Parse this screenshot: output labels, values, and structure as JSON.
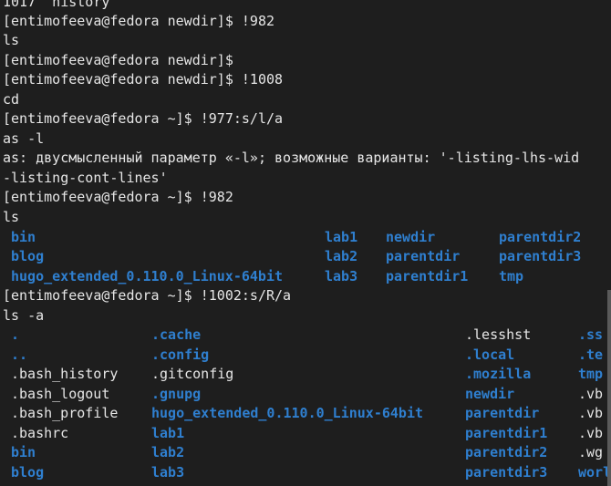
{
  "terminal": {
    "history_tail": "1017  history",
    "blocks": [
      {
        "prompt": "[entimofeeva@fedora newdir]$ ",
        "command": "!982"
      },
      {
        "output": "ls"
      },
      {
        "prompt": "[entimofeeva@fedora newdir]$ ",
        "command": ""
      },
      {
        "prompt": "[entimofeeva@fedora newdir]$ ",
        "command": "!1008"
      },
      {
        "output": "cd"
      },
      {
        "prompt": "[entimofeeva@fedora ~]$ ",
        "command": "!977:s/l/a"
      },
      {
        "output": "as -l"
      },
      {
        "output": "as: двусмысленный параметр «-l»; возможные варианты: '-listing-lhs-wid"
      },
      {
        "output": "-listing-cont-lines'"
      },
      {
        "prompt": "[entimofeeva@fedora ~]$ ",
        "command": "!982"
      },
      {
        "output": "ls"
      }
    ],
    "ls_output": {
      "col1": [
        "bin",
        "blog",
        "hugo_extended_0.110.0_Linux-64bit"
      ],
      "col2": [
        "lab1",
        "lab2",
        "lab3"
      ],
      "col3": [
        "newdir",
        "parentdir",
        "parentdir1"
      ],
      "col4": [
        "parentdir2",
        "parentdir3",
        "tmp"
      ]
    },
    "prompt2": {
      "prompt": "[entimofeeva@fedora ~]$ ",
      "command": "!1002:s/R/a"
    },
    "cmd2_echo": "ls -a",
    "ls_a_output": {
      "col1": [
        {
          "name": ".",
          "type": "dir"
        },
        {
          "name": "..",
          "type": "dir"
        },
        {
          "name": ".bash_history",
          "type": "file"
        },
        {
          "name": ".bash_logout",
          "type": "file"
        },
        {
          "name": ".bash_profile",
          "type": "file"
        },
        {
          "name": ".bashrc",
          "type": "file"
        },
        {
          "name": "bin",
          "type": "dir"
        },
        {
          "name": "blog",
          "type": "dir"
        }
      ],
      "col2": [
        {
          "name": ".cache",
          "type": "dir"
        },
        {
          "name": ".config",
          "type": "dir"
        },
        {
          "name": ".gitconfig",
          "type": "file"
        },
        {
          "name": ".gnupg",
          "type": "dir"
        },
        {
          "name": "hugo_extended_0.110.0_Linux-64bit",
          "type": "dir"
        },
        {
          "name": "lab1",
          "type": "dir"
        },
        {
          "name": "lab2",
          "type": "dir"
        },
        {
          "name": "lab3",
          "type": "dir"
        }
      ],
      "col3": [
        {
          "name": ".lesshst",
          "type": "file"
        },
        {
          "name": ".local",
          "type": "dir"
        },
        {
          "name": ".mozilla",
          "type": "dir"
        },
        {
          "name": "newdir",
          "type": "dir"
        },
        {
          "name": "parentdir",
          "type": "dir"
        },
        {
          "name": "parentdir1",
          "type": "dir"
        },
        {
          "name": "parentdir2",
          "type": "dir"
        },
        {
          "name": "parentdir3",
          "type": "dir"
        }
      ],
      "col4": [
        {
          "name": ".ss",
          "type": "dir"
        },
        {
          "name": ".te",
          "type": "dir"
        },
        {
          "name": "tmp",
          "type": "dir"
        },
        {
          "name": ".vb",
          "type": "file"
        },
        {
          "name": ".vb",
          "type": "file"
        },
        {
          "name": ".vb",
          "type": "file"
        },
        {
          "name": ".wg",
          "type": "file"
        },
        {
          "name": "worl",
          "type": "dir"
        }
      ]
    },
    "colors": {
      "background": "#1e1e1e",
      "text": "#e6e6e6",
      "directory": "#2f7fcf"
    }
  }
}
